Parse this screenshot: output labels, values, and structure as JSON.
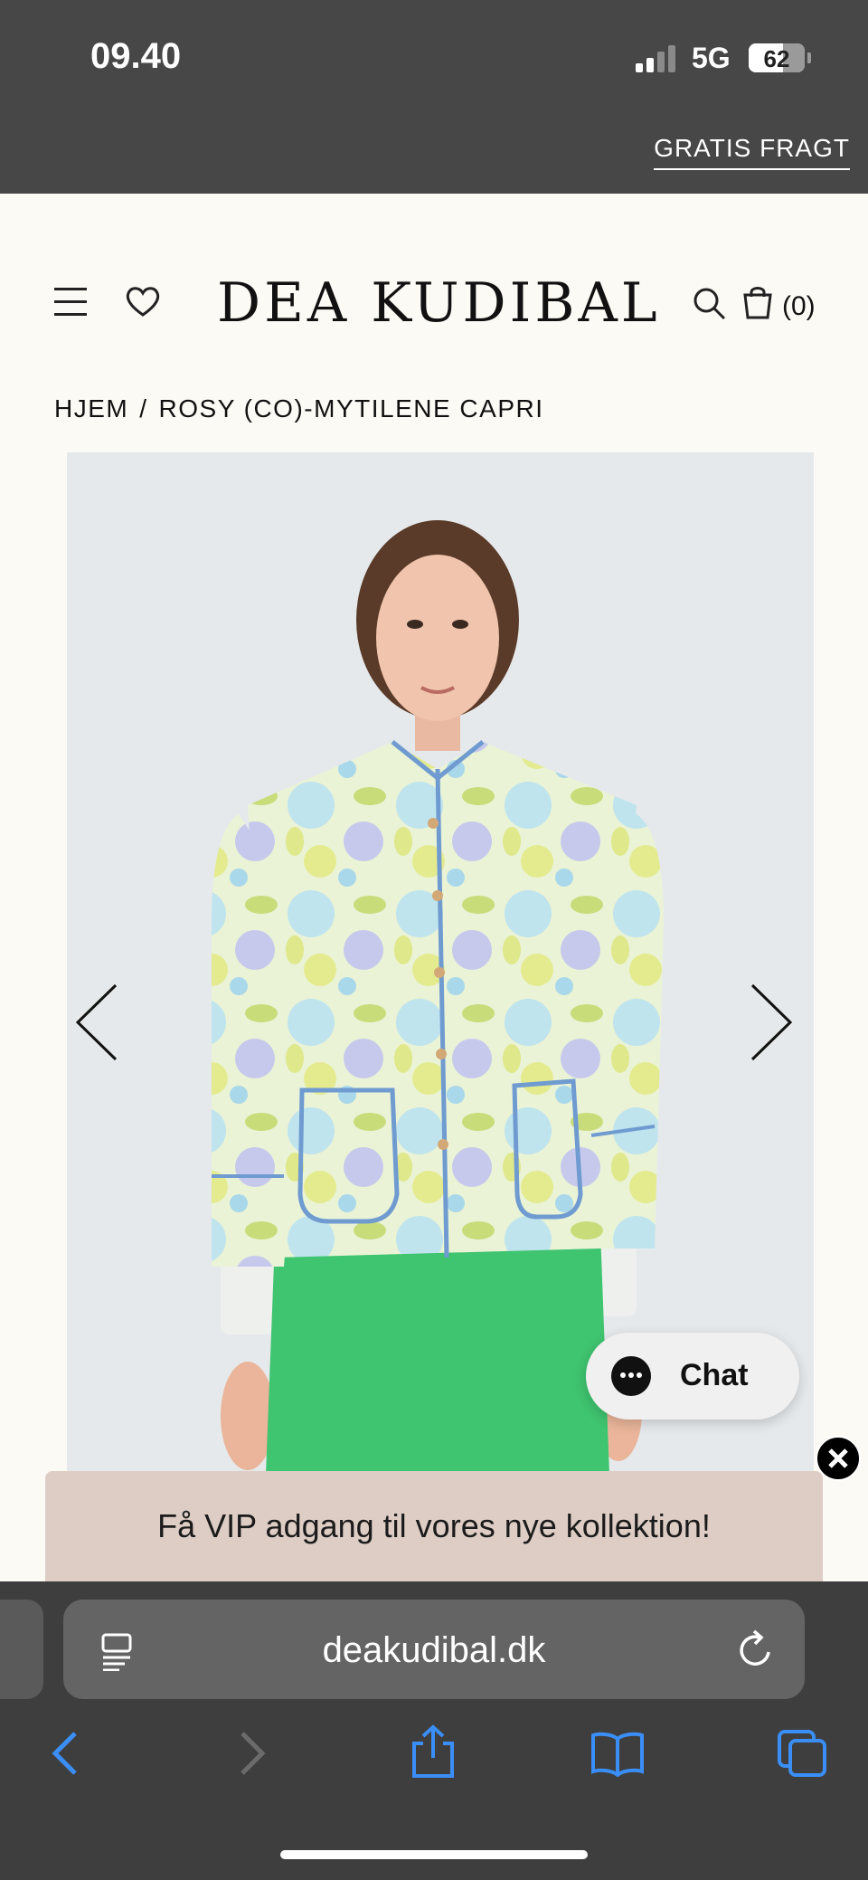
{
  "status": {
    "time": "09.40",
    "network": "5G",
    "battery": "62",
    "battery_level": 0.62
  },
  "promo": {
    "label": "GRATIS FRAGT"
  },
  "header": {
    "logo": "DEA KUDIBAL",
    "cart_count": "(0)",
    "icons": [
      "menu-icon",
      "heart-icon",
      "search-icon",
      "bag-icon"
    ]
  },
  "breadcrumb": {
    "home": "HJEM",
    "separator": "/",
    "current": "ROSY (CO)-MYTILENE CAPRI"
  },
  "chat": {
    "label": "Chat"
  },
  "vip": {
    "text": "Få VIP adgang til vores nye kollektion!"
  },
  "browser": {
    "url": "deakudibal.dk",
    "accent": "#3a8ef6"
  },
  "colors": {
    "header_bg": "#474747",
    "page_bg": "#fcfaf4",
    "vip_bg": "#decdc5",
    "pants": "#3fc46f"
  }
}
